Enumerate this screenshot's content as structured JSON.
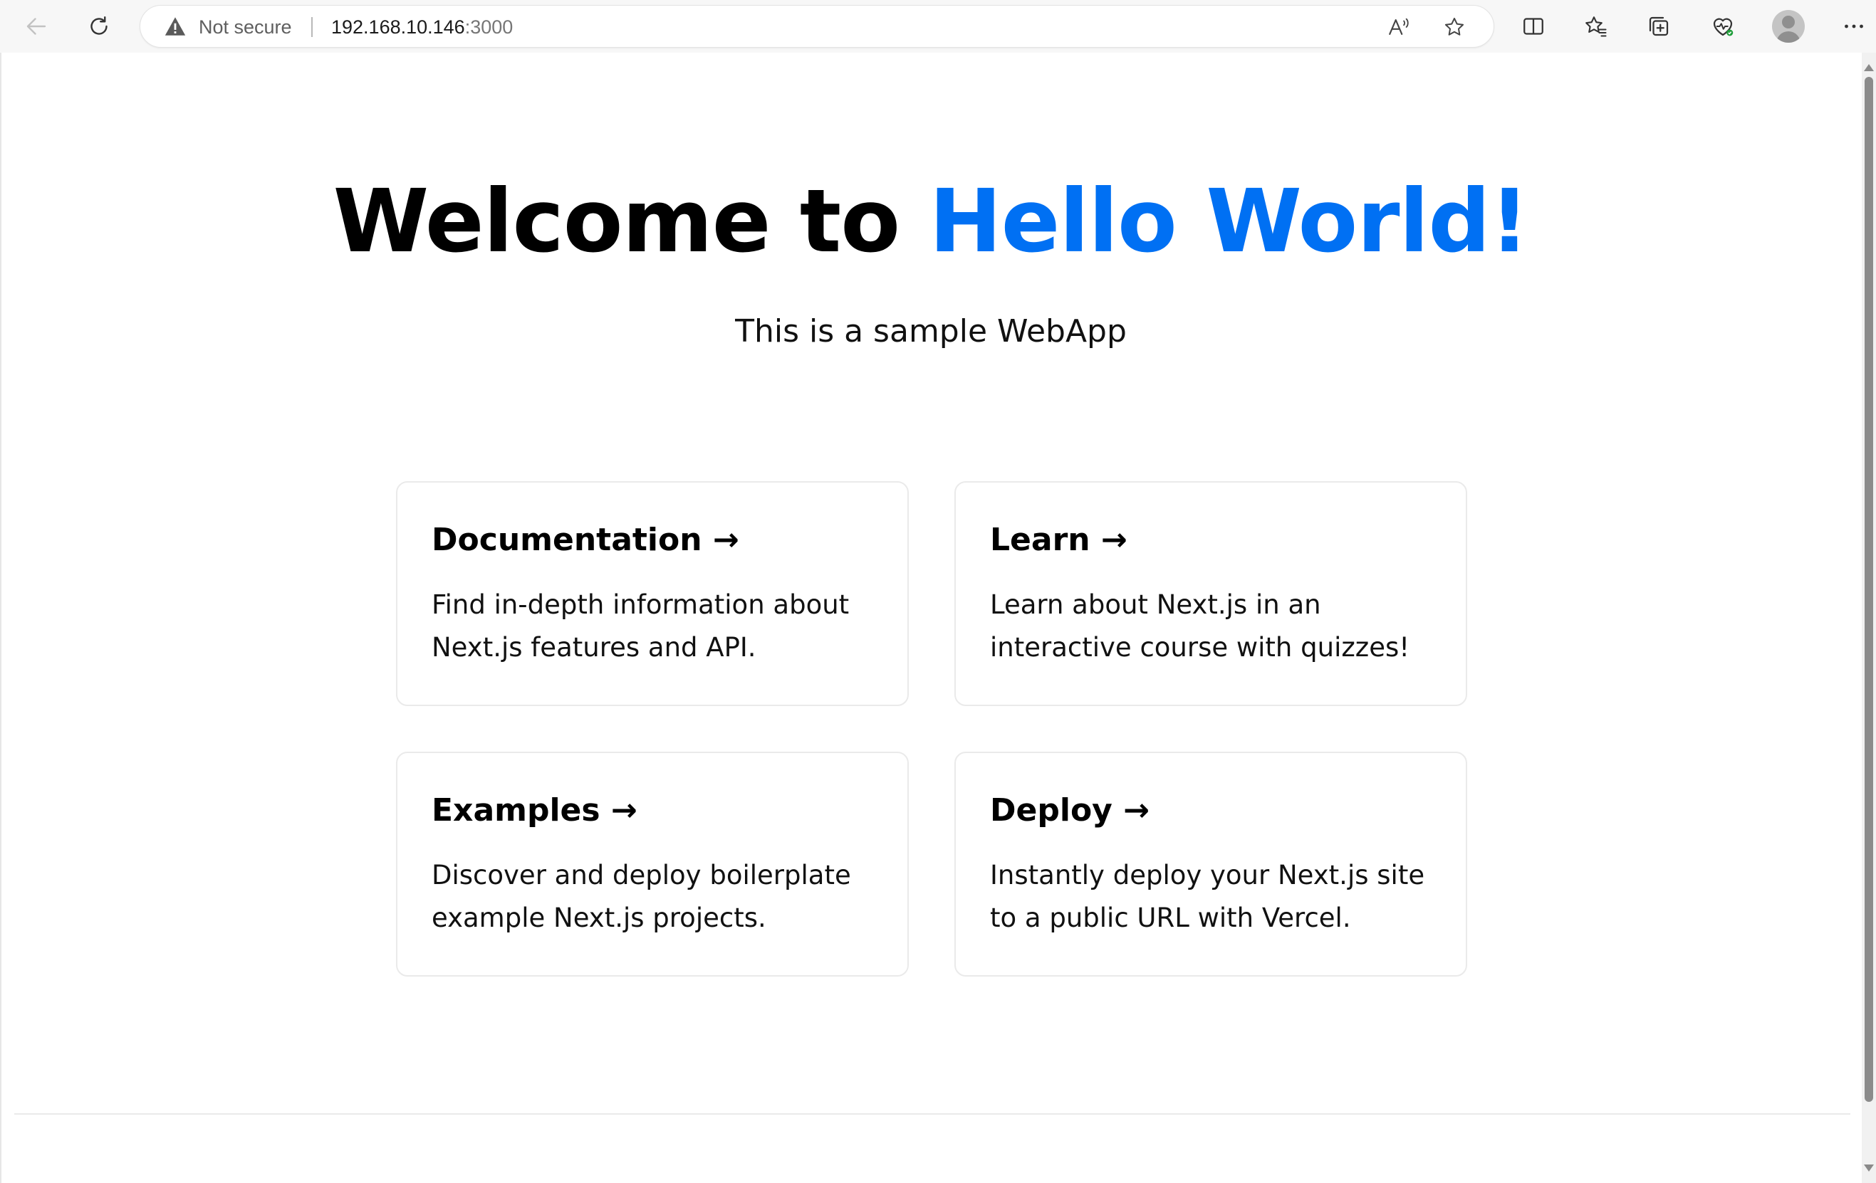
{
  "browser": {
    "not_secure_label": "Not secure",
    "url_host": "192.168.10.146",
    "url_port": ":3000",
    "icons": {
      "back": "back-arrow-icon",
      "refresh": "refresh-icon",
      "warning": "warning-icon",
      "read_aloud": "read-aloud-icon",
      "favorite": "star-icon",
      "split_screen": "split-screen-icon",
      "favorites": "favorites-icon",
      "collections": "collections-icon",
      "performance": "browser-essentials-icon",
      "profile": "profile-avatar",
      "more": "more-menu-icon"
    }
  },
  "page": {
    "title_prefix": "Welcome to ",
    "title_accent": "Hello World!",
    "subtitle": "This is a sample WebApp",
    "accent_color": "#0070f3",
    "cards": [
      {
        "title": "Documentation →",
        "description": "Find in-depth information about Next.js features and API."
      },
      {
        "title": "Learn →",
        "description": "Learn about Next.js in an interactive course with quizzes!"
      },
      {
        "title": "Examples →",
        "description": "Discover and deploy boilerplate example Next.js projects."
      },
      {
        "title": "Deploy →",
        "description": "Instantly deploy your Next.js site to a public URL with Vercel."
      }
    ]
  }
}
